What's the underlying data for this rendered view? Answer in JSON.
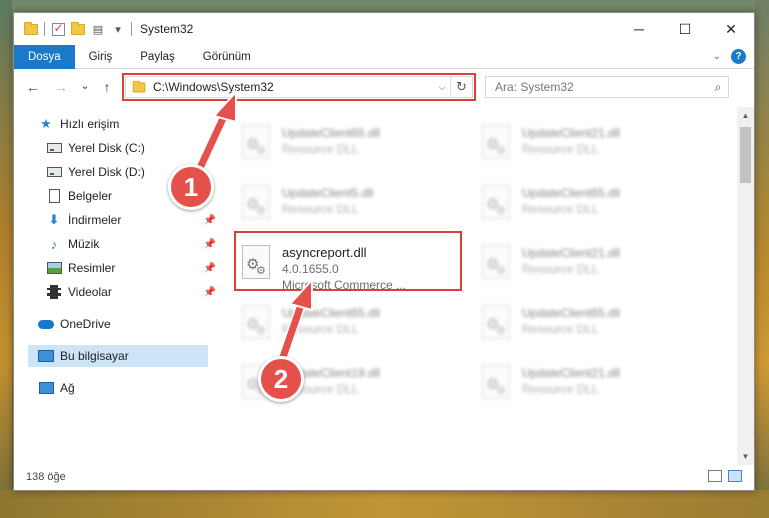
{
  "window": {
    "title": "System32",
    "minimize_glyph": "─",
    "maximize_glyph": "☐",
    "close_glyph": "✕"
  },
  "ribbon": {
    "tabs": [
      {
        "label": "Dosya"
      },
      {
        "label": "Giriş"
      },
      {
        "label": "Paylaş"
      },
      {
        "label": "Görünüm"
      }
    ],
    "help_glyph": "?"
  },
  "navigation": {
    "back_glyph": "←",
    "forward_glyph": "→",
    "recent_glyph": "⌄",
    "up_glyph": "↑",
    "address_path": "C:\\Windows\\System32",
    "search_placeholder": "Ara: System32"
  },
  "sidebar": {
    "items": [
      {
        "label": "Hızlı erişim",
        "icon": "star-icon"
      },
      {
        "label": "Yerel Disk (C:)",
        "icon": "drive-icon"
      },
      {
        "label": "Yerel Disk (D:)",
        "icon": "drive-icon"
      },
      {
        "label": "Belgeler",
        "icon": "documents-icon"
      },
      {
        "label": "İndirmeler",
        "icon": "download-icon"
      },
      {
        "label": "Müzik",
        "icon": "music-icon"
      },
      {
        "label": "Resimler",
        "icon": "pictures-icon"
      },
      {
        "label": "Videolar",
        "icon": "videos-icon"
      },
      {
        "label": "OneDrive",
        "icon": "cloud-icon"
      },
      {
        "label": "Bu bilgisayar",
        "icon": "computer-icon"
      },
      {
        "label": "Ağ",
        "icon": "network-icon"
      }
    ]
  },
  "files": [
    {
      "name": "UpdateClient65.dll",
      "sub": "Resource DLL",
      "blurred": true
    },
    {
      "name": "UpdateClient21.dll",
      "sub": "Resource DLL",
      "blurred": true
    },
    {
      "name": "UpdateClient5.dll",
      "sub": "Resource DLL",
      "blurred": true
    },
    {
      "name": "UpdateClient65.dll",
      "sub": "Resource DLL",
      "blurred": true
    },
    {
      "name": "asyncreport.dll",
      "version": "4.0.1655.0",
      "sub": "Microsoft Commerce ...",
      "blurred": false
    },
    {
      "name": "UpdateClient21.dll",
      "sub": "Resource DLL",
      "blurred": true
    },
    {
      "name": "UpdateClient65.dll",
      "sub": "Resource DLL",
      "blurred": true
    },
    {
      "name": "UpdateClient65.dll",
      "sub": "Resource DLL",
      "blurred": true
    },
    {
      "name": "UpdateClient19.dll",
      "sub": "Resource DLL",
      "blurred": true
    },
    {
      "name": "UpdateClient21.dll",
      "sub": "Resource DLL",
      "blurred": true
    }
  ],
  "status": {
    "item_count": "138 öğe"
  },
  "callouts": {
    "step1": "1",
    "step2": "2",
    "color": "#d9403a"
  }
}
